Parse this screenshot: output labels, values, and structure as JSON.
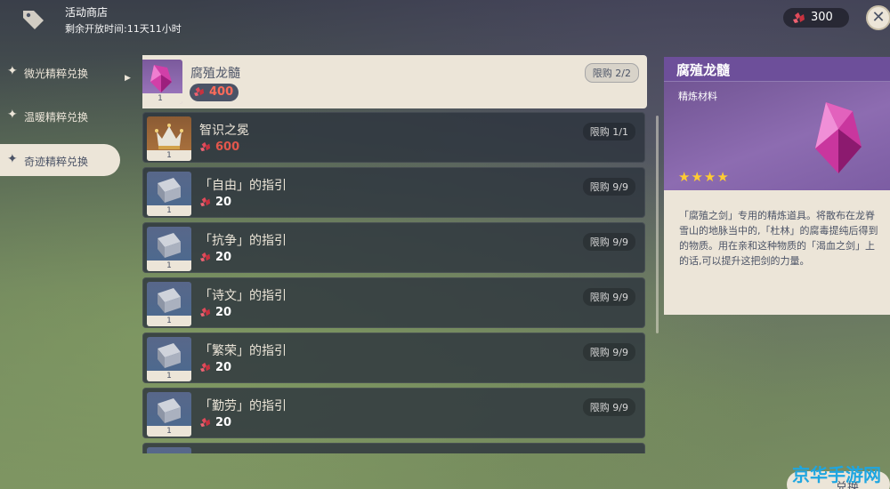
{
  "header": {
    "shop_title": "活动商店",
    "time_remaining": "剩余开放时间:11天11小时",
    "currency_amount": "300",
    "currency_icon": "crystal-currency-icon",
    "close_icon": "close-icon"
  },
  "sidebar": {
    "items": [
      {
        "label": "微光精粹兑换",
        "active": false
      },
      {
        "label": "温暖精粹兑换",
        "active": false
      },
      {
        "label": "奇迹精粹兑换",
        "active": true
      }
    ]
  },
  "items": [
    {
      "name": "腐殖龙髓",
      "price": "400",
      "limit": "限购 2/2",
      "qty": "1",
      "selected": true,
      "icon": "crystal-icon"
    },
    {
      "name": "智识之冕",
      "price": "600",
      "limit": "限购 1/1",
      "qty": "1",
      "selected": false,
      "icon": "crown-icon"
    },
    {
      "name": "「自由」的指引",
      "price": "20",
      "limit": "限购 9/9",
      "qty": "1",
      "selected": false,
      "icon": "book-icon"
    },
    {
      "name": "「抗争」的指引",
      "price": "20",
      "limit": "限购 9/9",
      "qty": "1",
      "selected": false,
      "icon": "book-icon"
    },
    {
      "name": "「诗文」的指引",
      "price": "20",
      "limit": "限购 9/9",
      "qty": "1",
      "selected": false,
      "icon": "book-icon"
    },
    {
      "name": "「繁荣」的指引",
      "price": "20",
      "limit": "限购 9/9",
      "qty": "1",
      "selected": false,
      "icon": "book-icon"
    },
    {
      "name": "「勤劳」的指引",
      "price": "20",
      "limit": "限购 9/9",
      "qty": "1",
      "selected": false,
      "icon": "book-icon"
    }
  ],
  "detail": {
    "title": "腐殖龙髓",
    "type": "精炼材料",
    "stars": "★★★★",
    "rarity": 4,
    "description": "「腐殖之剑」专用的精炼道具。将散布在龙脊雪山的地脉当中的,「杜林」的腐毒提纯后得到的物质。用在亲和这种物质的「渴血之剑」上的话,可以提升这把剑的力量。"
  },
  "footer": {
    "exchange_label": "兑换",
    "watermark": "京华手游网"
  },
  "colors": {
    "accent_cream": "#ece5d8",
    "text_dark": "#4b5366",
    "price_red": "#e2574c",
    "rarity_purple": "#8d6cb1",
    "star_gold": "#ffcc32"
  }
}
